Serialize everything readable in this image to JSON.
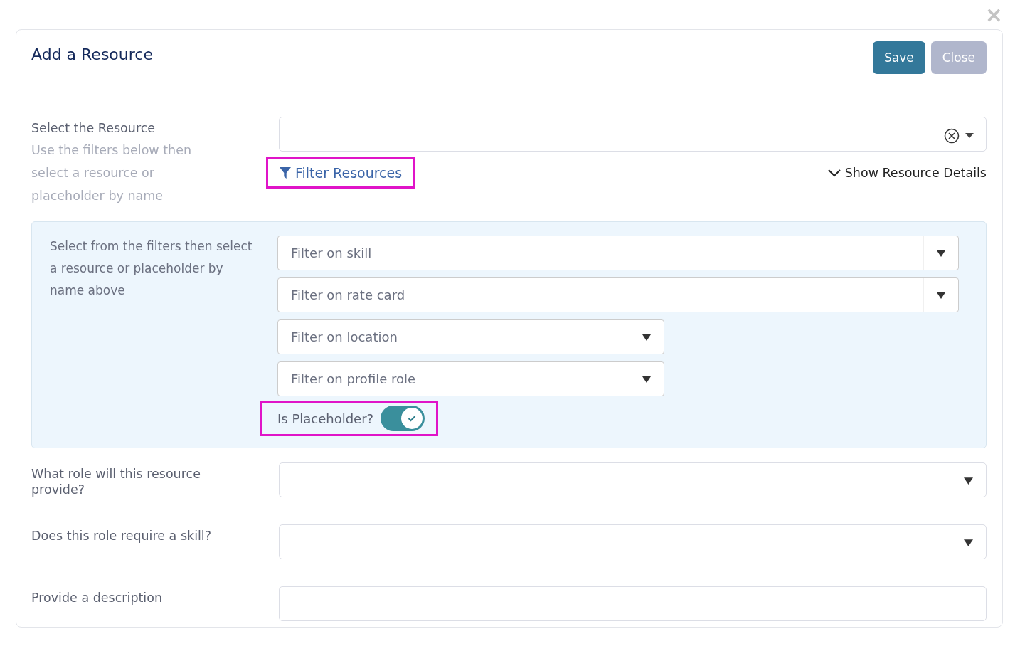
{
  "dialog": {
    "title": "Add a Resource",
    "close_symbol": "×",
    "buttons": [
      {
        "label": "Save",
        "disabled": false
      },
      {
        "label": "Close",
        "disabled": true
      }
    ]
  },
  "resource": {
    "label": "Select the Resource",
    "hint": "Use the filters below then select a resource or placeholder by name",
    "filter_link": {
      "label": "Filter Resources",
      "highlighted": true
    },
    "details_link": "Show Resource Details"
  },
  "filters": {
    "hint": "Select from the filters then select a resource or placeholder by name above",
    "items": [
      {
        "placeholder": "Filter on skill",
        "kind": "wide"
      },
      {
        "placeholder": "Filter on rate card",
        "kind": "wide"
      },
      {
        "placeholder": "Filter on location",
        "kind": "narrow"
      },
      {
        "placeholder": "Filter on profile role",
        "kind": "narrow"
      }
    ],
    "placeholder_toggle": {
      "label": "Is Placeholder?",
      "on": true,
      "highlighted": true
    }
  },
  "fields": [
    {
      "label": "What role will this resource provide?",
      "kind": "select"
    },
    {
      "label": "Does this role require a skill?",
      "kind": "select"
    },
    {
      "label": "Provide a description",
      "kind": "text"
    }
  ]
}
